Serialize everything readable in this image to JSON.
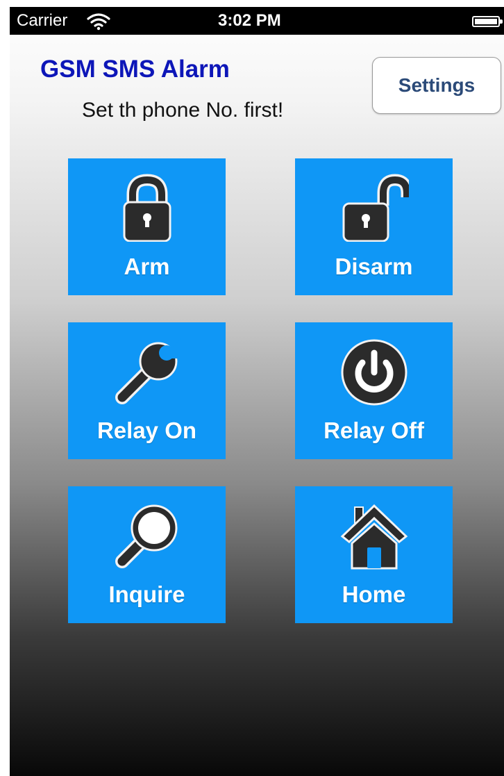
{
  "status_bar": {
    "carrier": "Carrier",
    "time": "3:02 PM",
    "wifi_icon": "wifi-icon",
    "battery_icon": "battery-icon"
  },
  "header": {
    "title": "GSM SMS Alarm",
    "subtitle": "Set th phone No. first!",
    "settings_label": "Settings"
  },
  "tiles": [
    {
      "label": "Arm",
      "icon": "lock-closed-icon"
    },
    {
      "label": "Disarm",
      "icon": "lock-open-icon"
    },
    {
      "label": "Relay On",
      "icon": "wrench-icon"
    },
    {
      "label": "Relay Off",
      "icon": "power-icon"
    },
    {
      "label": "Inquire",
      "icon": "magnifier-icon"
    },
    {
      "label": "Home",
      "icon": "house-icon"
    }
  ],
  "colors": {
    "title": "#0d16b8",
    "tile_background": "#0f97f6",
    "settings_text": "#2b4a78",
    "icon_fill": "#2b2b2b"
  }
}
